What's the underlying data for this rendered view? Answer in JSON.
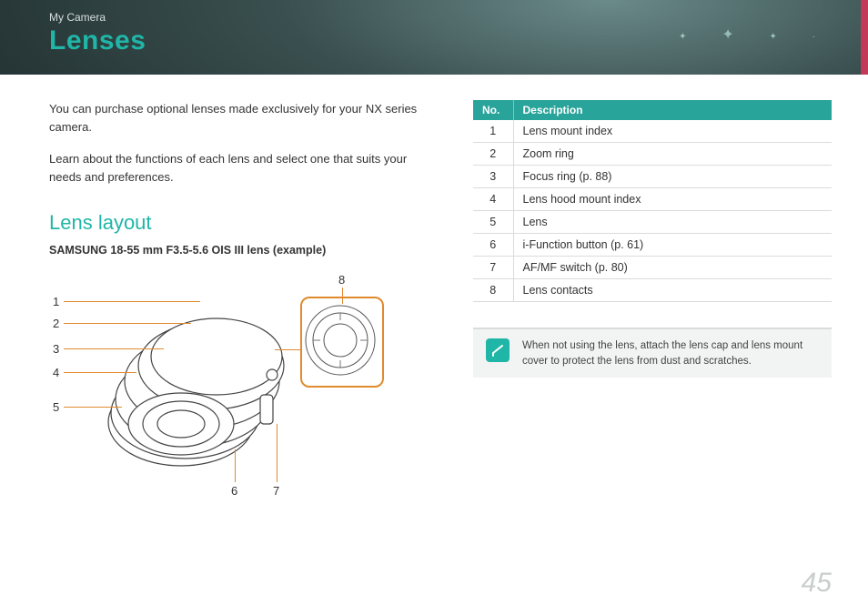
{
  "header": {
    "breadcrumb": "My Camera",
    "title": "Lenses"
  },
  "intro": {
    "p1": "You can purchase optional lenses made exclusively for your NX series camera.",
    "p2": "Learn about the functions of each lens and select one that suits your needs and preferences."
  },
  "section": {
    "heading": "Lens layout",
    "subhead": "SAMSUNG 18-55 mm F3.5-5.6 OIS III lens (example)"
  },
  "diagram": {
    "labels": {
      "1": "1",
      "2": "2",
      "3": "3",
      "4": "4",
      "5": "5",
      "6": "6",
      "7": "7",
      "8": "8"
    }
  },
  "table": {
    "head": {
      "no": "No.",
      "desc": "Description"
    },
    "rows": [
      {
        "no": "1",
        "desc": "Lens mount index"
      },
      {
        "no": "2",
        "desc": "Zoom ring"
      },
      {
        "no": "3",
        "desc": "Focus ring (p. 88)"
      },
      {
        "no": "4",
        "desc": "Lens hood mount index"
      },
      {
        "no": "5",
        "desc": "Lens"
      },
      {
        "no": "6",
        "desc": "i-Function button (p. 61)"
      },
      {
        "no": "7",
        "desc": "AF/MF switch (p. 80)"
      },
      {
        "no": "8",
        "desc": "Lens contacts"
      }
    ]
  },
  "note": {
    "text": "When not using the lens, attach the lens cap and lens mount cover to protect the lens from dust and scratches."
  },
  "page_number": "45"
}
